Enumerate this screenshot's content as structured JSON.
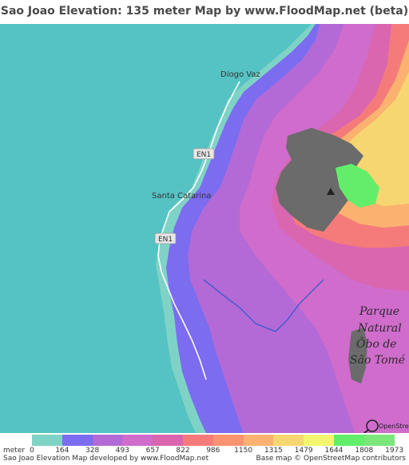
{
  "title": "Sao Joao Elevation: 135 meter Map by www.FloodMap.net (beta)",
  "map": {
    "places": {
      "diogo_vaz": "Diogo Vaz",
      "santa_catarina": "Santa Catarina"
    },
    "roads": {
      "en1_north": "EN1",
      "en1_south": "EN1"
    },
    "park": {
      "line1": "Parque",
      "line2": "Natural",
      "line3": "Ôbo de",
      "line4": "São Tomé"
    },
    "osm_badge": "OpenStreetMap"
  },
  "legend": {
    "unit": "meter",
    "ticks": [
      "0",
      "164",
      "328",
      "493",
      "657",
      "822",
      "986",
      "1150",
      "1315",
      "1479",
      "1644",
      "1808",
      "1973"
    ],
    "colors": [
      "#7fd3c6",
      "#7b6cf0",
      "#b36ad6",
      "#cf6ccc",
      "#d966ae",
      "#f57b7b",
      "#fb9270",
      "#fbb270",
      "#f6d670",
      "#f3f56e",
      "#62ee6a",
      "#7ce67a"
    ]
  },
  "footer": {
    "left": "Sao Joao Elevation Map developed by www.FloodMap.net",
    "right": "Base map © OpenStreetMap contributors"
  },
  "colors": {
    "sea": "#55c3c4",
    "coast": "#7fd3c6",
    "low": "#7b6cf0",
    "mid": "#b36ad6",
    "high": "#cf6ccc",
    "urban": "#6b6b6b",
    "peak_yellow": "#f6d670",
    "peak_green": "#62ee6a"
  }
}
